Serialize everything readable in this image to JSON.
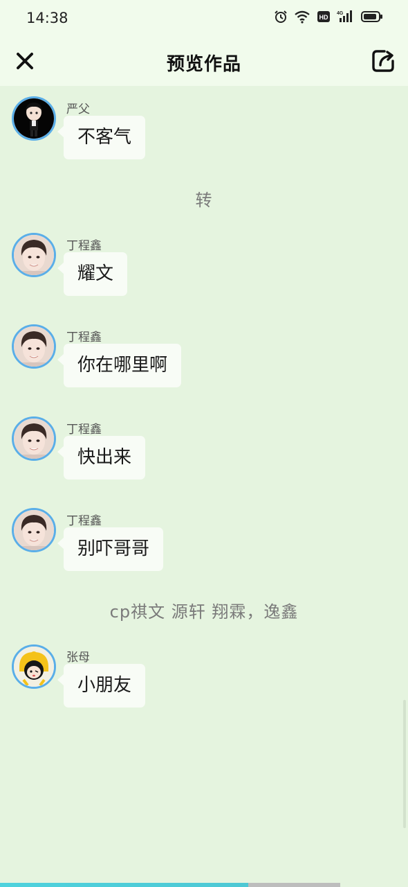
{
  "status_bar": {
    "time": "14:38",
    "icons": [
      "alarm-icon",
      "wifi-icon",
      "hd-icon",
      "4g-signal-icon",
      "battery-icon"
    ],
    "network_label": "4G",
    "hd_label": "HD"
  },
  "nav": {
    "title": "预览作品",
    "close_icon": "close-icon",
    "share_icon": "share-icon"
  },
  "messages": [
    {
      "type": "chat",
      "sender": "严父",
      "text": "不客气",
      "avatar": "yan-fu-avatar"
    },
    {
      "type": "narration",
      "text": "转"
    },
    {
      "type": "chat",
      "sender": "丁程鑫",
      "text": "耀文",
      "avatar": "ding-chengxin-avatar"
    },
    {
      "type": "chat",
      "sender": "丁程鑫",
      "text": "你在哪里啊",
      "avatar": "ding-chengxin-avatar"
    },
    {
      "type": "chat",
      "sender": "丁程鑫",
      "text": "快出来",
      "avatar": "ding-chengxin-avatar"
    },
    {
      "type": "chat",
      "sender": "丁程鑫",
      "text": "别吓哥哥",
      "avatar": "ding-chengxin-avatar"
    },
    {
      "type": "narration",
      "text": "cp祺文  源轩  翔霖，逸鑫"
    },
    {
      "type": "chat",
      "sender": "张母",
      "text": "小朋友",
      "avatar": "zhang-mu-avatar"
    }
  ],
  "progress": {
    "fraction": 0.73
  },
  "colors": {
    "background": "#e5f4df",
    "header": "#f1fbec",
    "bubble": "#f8fcf6",
    "avatar_border": "#5aaee8",
    "progress": "#4fd2dd"
  }
}
